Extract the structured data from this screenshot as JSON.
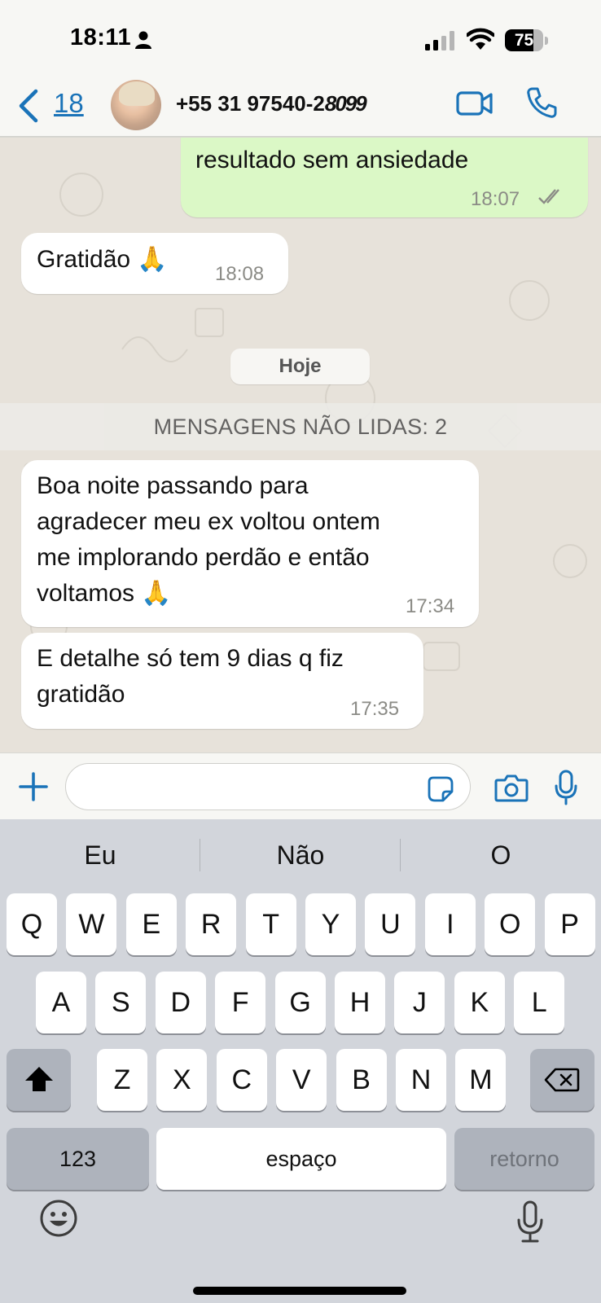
{
  "status_bar": {
    "time": "18:11",
    "battery": "75",
    "battery_level": 0.75
  },
  "header": {
    "back_count": "18",
    "contact": "+55 31 97540-2",
    "contact_redacted": "8099",
    "icons": [
      "back-chevron-icon",
      "video-call-icon",
      "phone-call-icon"
    ]
  },
  "messages": [
    {
      "direction": "out",
      "text_line1": "",
      "text_line2": "resultado sem ansiedade",
      "time": "18:07",
      "status": "read"
    },
    {
      "direction": "in",
      "text": "Gratidão 🙏",
      "time": "18:08"
    },
    {
      "direction": "in",
      "lines": [
        "Boa noite passando para",
        "agradecer meu ex voltou ontem",
        "me implorando perdão e então",
        "voltamos 🙏"
      ],
      "time": "17:34"
    },
    {
      "direction": "in",
      "lines": [
        "E detalhe só tem 9 dias q fiz",
        "gratidão"
      ],
      "time": "17:35"
    }
  ],
  "date_pill": "Hoje",
  "unread_banner": "MENSAGENS NÃO LIDAS: 2",
  "input": {
    "placeholder": ""
  },
  "keyboard": {
    "suggestions": [
      "Eu",
      "Não",
      "O"
    ],
    "row1": [
      "Q",
      "W",
      "E",
      "R",
      "T",
      "Y",
      "U",
      "I",
      "O",
      "P"
    ],
    "row2": [
      "A",
      "S",
      "D",
      "F",
      "G",
      "H",
      "J",
      "K",
      "L"
    ],
    "row3": [
      "Z",
      "X",
      "C",
      "V",
      "B",
      "N",
      "M"
    ],
    "numbers_key": "123",
    "space_key": "espaço",
    "return_key": "retorno"
  }
}
